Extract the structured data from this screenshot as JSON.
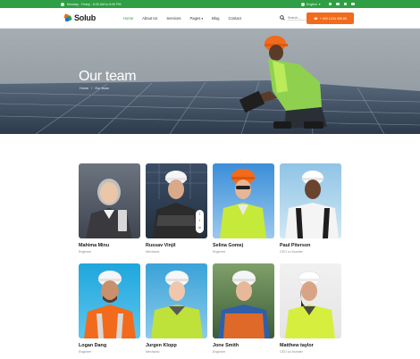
{
  "topbar": {
    "hours": "Monday - Friday : 8:30 AM to 8:00 PM",
    "language": "English",
    "social_icons": [
      "facebook-icon",
      "twitter-icon",
      "linkedin-icon",
      "instagram-icon"
    ]
  },
  "header": {
    "logo_text": "Solub",
    "nav": [
      {
        "label": "Home",
        "active": true
      },
      {
        "label": "About Us",
        "active": false
      },
      {
        "label": "Services",
        "active": false
      },
      {
        "label": "Pages",
        "active": false
      },
      {
        "label": "Blog",
        "active": false
      },
      {
        "label": "Contact",
        "active": false
      }
    ],
    "search_placeholder": "Search ...",
    "cta_label": "+ 000 1234 456 89"
  },
  "hero": {
    "title": "Our team",
    "breadcrumb": [
      "Home",
      "/",
      "Our team"
    ]
  },
  "team": [
    {
      "name": "Mahima Minu",
      "role": "Engineer"
    },
    {
      "name": "Russav Vinjil",
      "role": "Mechanic"
    },
    {
      "name": "Selina Gomej",
      "role": "Engineer"
    },
    {
      "name": "Paul Piterson",
      "role": "CEO co founder"
    },
    {
      "name": "Logan Dang",
      "role": "Engineer"
    },
    {
      "name": "Jurgen Klopp",
      "role": "Mechanic"
    },
    {
      "name": "Jone Smith",
      "role": "Engineer"
    },
    {
      "name": "Matthew taylor",
      "role": "CEO co founder"
    }
  ],
  "colors": {
    "brand_green": "#2f9e44",
    "accent_orange": "#f26a1b"
  }
}
